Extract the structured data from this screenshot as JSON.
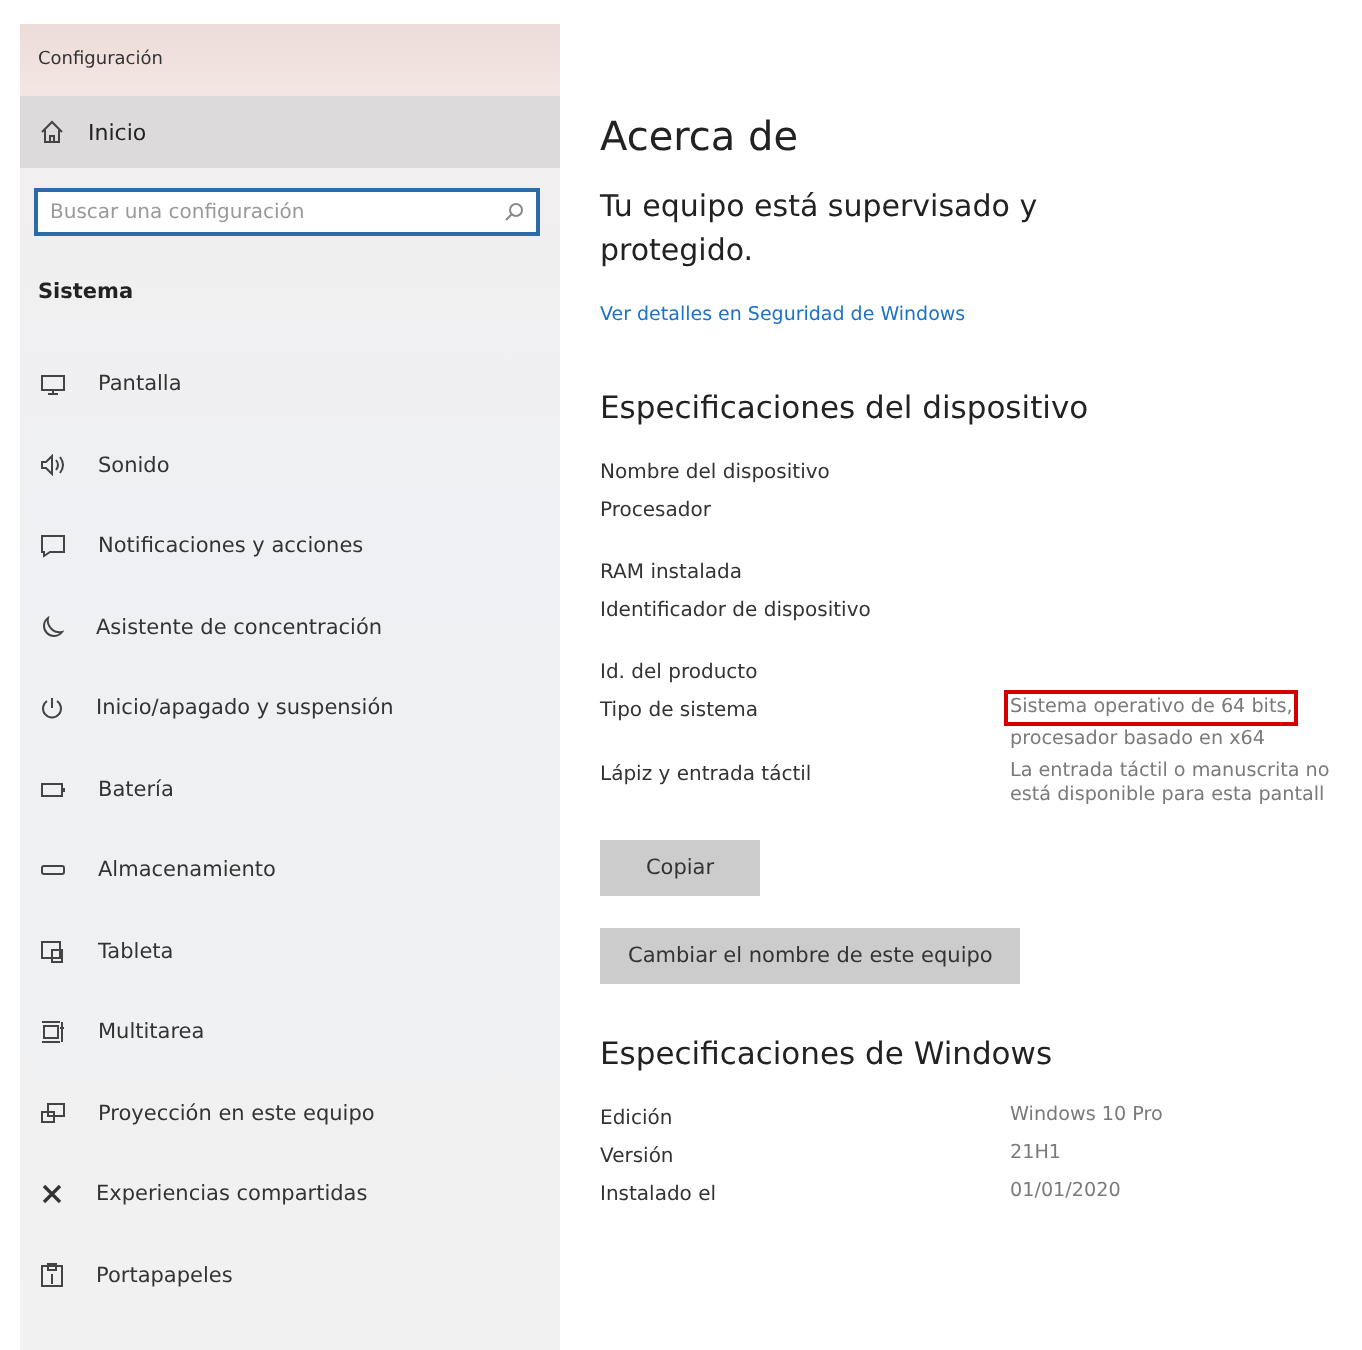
{
  "window": {
    "title": "Configuración"
  },
  "sidebar": {
    "home": {
      "label": "Inicio",
      "selected": true
    },
    "search": {
      "placeholder": "Buscar una configuración"
    },
    "section": "Sistema",
    "items": [
      {
        "label": "Pantalla",
        "selected": false
      },
      {
        "label": "Sonido",
        "selected": false
      },
      {
        "label": "Notificaciones y acciones",
        "selected": false
      },
      {
        "label": "Asistente de concentración",
        "selected": false
      },
      {
        "label": "Inicio/apagado y suspensión",
        "selected": false
      },
      {
        "label": "Batería",
        "selected": false
      },
      {
        "label": "Almacenamiento",
        "selected": false
      },
      {
        "label": "Tableta",
        "selected": false
      },
      {
        "label": "Multitarea",
        "selected": false
      },
      {
        "label": "Proyección en este equipo",
        "selected": false
      },
      {
        "label": "Experiencias compartidas",
        "selected": false
      },
      {
        "label": "Portapapeles",
        "selected": false
      }
    ]
  },
  "content": {
    "title": "Acerca de",
    "status": "Tu equipo está supervisado y protegido.",
    "link": "Ver detalles en Seguridad de Windows",
    "device_specs": {
      "heading": "Especificaciones del dispositivo",
      "groups": [
        [
          {
            "label": "Nombre del dispositivo"
          },
          {
            "label": "Procesador"
          }
        ],
        [
          {
            "label": "RAM instalada"
          },
          {
            "label": "Identificador de dispositivo"
          }
        ],
        [
          {
            "label": "Id. del producto"
          },
          {
            "label": "Tipo de sistema",
            "value": [
              "Sistema operativo de 64 bits,",
              "procesador basado en x64"
            ],
            "highlighted": true
          },
          {
            "label": "Lápiz y entrada táctil",
            "value": [
              "La entrada táctil o manuscrita no",
              "está disponible para esta pantall"
            ]
          }
        ]
      ]
    },
    "buttons": [
      "Copiar",
      "Cambiar el nombre de este equipo"
    ],
    "windows_specs": {
      "heading": "Especificaciones de Windows",
      "rows": [
        {
          "label": "Edición",
          "value": [
            "Windows 10 Pro"
          ]
        },
        {
          "label": "Versión",
          "value": [
            "21H1"
          ]
        },
        {
          "label": "Instalado el",
          "value": [
            "01/01/2020"
          ]
        }
      ]
    }
  }
}
